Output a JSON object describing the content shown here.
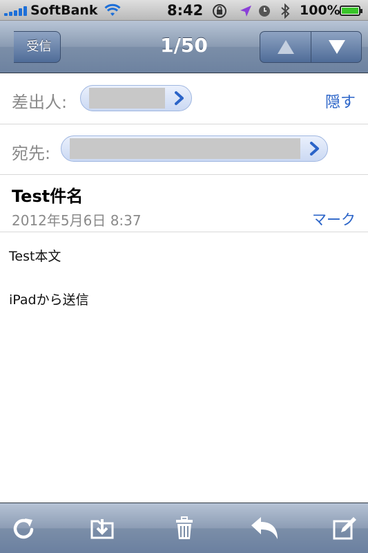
{
  "status_bar": {
    "carrier": "SoftBank",
    "time": "8:42",
    "battery_percent": "100%",
    "signal_bars": 5,
    "icons": [
      "wifi-icon",
      "rotation-lock-icon",
      "location-icon",
      "alarm-icon",
      "bluetooth-icon",
      "battery-icon"
    ]
  },
  "nav": {
    "back_label": "受信",
    "title": "1/50",
    "up_icon": "up-arrow-icon",
    "down_icon": "down-arrow-icon"
  },
  "header": {
    "from_label": "差出人:",
    "to_label": "宛先:",
    "hide_label": "隠す",
    "subject": "Test件名",
    "date": "2012年5月6日 8:37",
    "mark_label": "マーク"
  },
  "body": {
    "line1": "Test本文",
    "line2": "iPadから送信"
  },
  "toolbar": {
    "icons": [
      "refresh-icon",
      "move-to-folder-icon",
      "trash-icon",
      "reply-icon",
      "compose-icon"
    ]
  },
  "colors": {
    "link": "#2b64c8",
    "nav_blue": "#6d82a0",
    "battery_green": "#39c42a"
  }
}
